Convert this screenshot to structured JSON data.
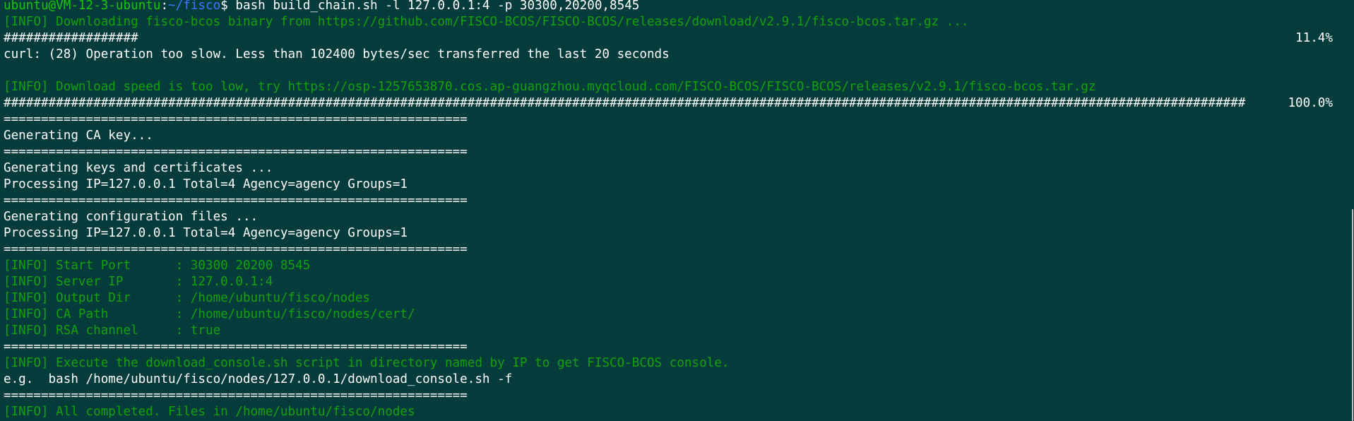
{
  "prompt": {
    "user_host": "ubuntu@VM-12-3-ubuntu",
    "sep": ":",
    "cwd": "~/fisco",
    "dollar": "$",
    "command": " bash build_chain.sh -l 127.0.0.1:4 -p 30300,20200,8545"
  },
  "output": {
    "download_info": "[INFO] Downloading fisco-bcos binary from https://github.com/FISCO-BCOS/FISCO-BCOS/releases/download/v2.9.1/fisco-bcos.tar.gz ...",
    "progress1_bar": "##################",
    "progress1_pct": "11.4%",
    "curl_error": "curl: (28) Operation too slow. Less than 102400 bytes/sec transferred the last 20 seconds",
    "blank1": "",
    "download_speed_info": "[INFO] Download speed is too low, try https://osp-1257653870.cos.ap-guangzhou.myqcloud.com/FISCO-BCOS/FISCO-BCOS/releases/v2.9.1/fisco-bcos.tar.gz",
    "progress2_bar": "######################################################################################################################################################################",
    "progress2_pct": "100.0%",
    "sep1": "==============================================================",
    "gen_ca": "Generating CA key...",
    "sep2": "==============================================================",
    "gen_keys": "Generating keys and certificates ...",
    "processing1": "Processing IP=127.0.0.1 Total=4 Agency=agency Groups=1",
    "sep3": "==============================================================",
    "gen_config": "Generating configuration files ...",
    "processing2": "Processing IP=127.0.0.1 Total=4 Agency=agency Groups=1",
    "sep4": "==============================================================",
    "info_start_port": "[INFO] Start Port      : 30300 20200 8545",
    "info_server_ip": "[INFO] Server IP       : 127.0.0.1:4",
    "info_output_dir": "[INFO] Output Dir      : /home/ubuntu/fisco/nodes",
    "info_ca_path": "[INFO] CA Path         : /home/ubuntu/fisco/nodes/cert/",
    "info_rsa": "[INFO] RSA channel     : true",
    "sep5": "==============================================================",
    "info_execute": "[INFO] Execute the download_console.sh script in directory named by IP to get FISCO-BCOS console.",
    "eg_line": "e.g.  bash /home/ubuntu/fisco/nodes/127.0.0.1/download_console.sh -f",
    "sep6": "==============================================================",
    "info_completed": "[INFO] All completed. Files in /home/ubuntu/fisco/nodes"
  },
  "colors": {
    "background": "#043b3b",
    "info_green": "#13a10e",
    "prompt_user": "#16c60c",
    "prompt_path": "#3b78ff",
    "text": "#ffffff"
  }
}
